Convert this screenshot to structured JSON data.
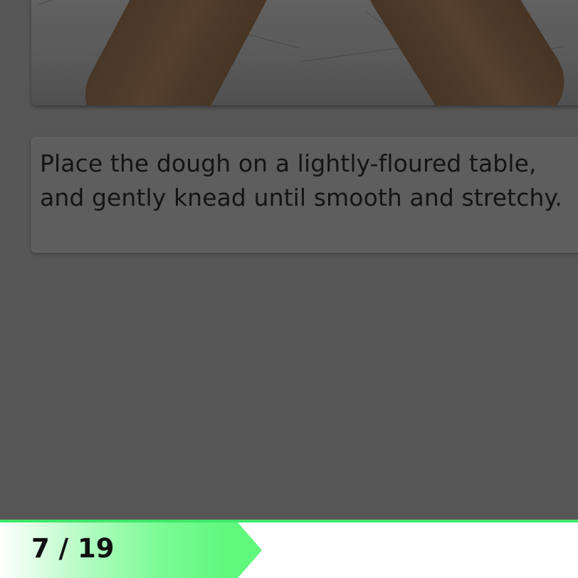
{
  "step": {
    "instruction": "Place the dough on a lightly-floured table, and gently knead until smooth and stretchy.",
    "current": 7,
    "total": 19,
    "counter_text": "7 / 19"
  },
  "progress": {
    "fraction": 0.368,
    "accent_color": "#3fe86a"
  },
  "image": {
    "subject": "hands-kneading-dough-photo"
  }
}
